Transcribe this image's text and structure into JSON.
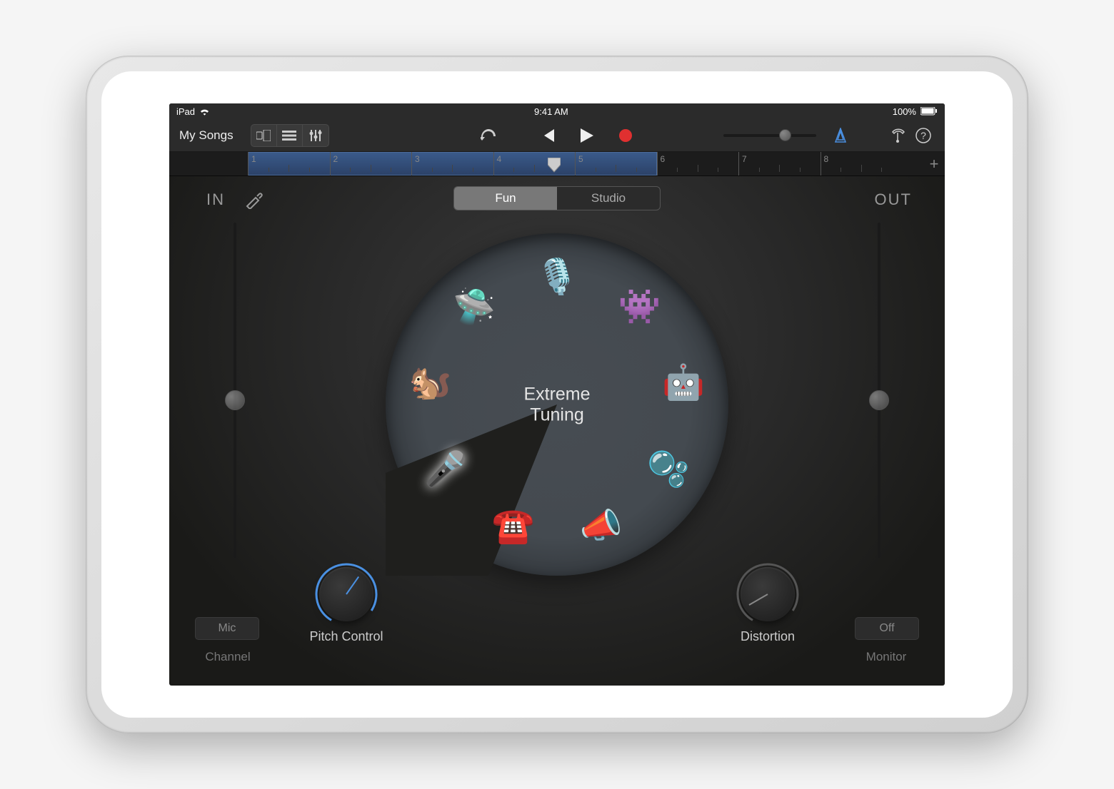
{
  "statusBar": {
    "device": "iPad",
    "time": "9:41 AM",
    "battery": "100%"
  },
  "header": {
    "back": "My Songs"
  },
  "ruler": {
    "bars": [
      "1",
      "2",
      "3",
      "4",
      "5",
      "6",
      "7",
      "8"
    ],
    "regionStartBar": 1,
    "regionEndBar": 5,
    "playheadBar": 4
  },
  "view": {
    "tabs": {
      "fun": "Fun",
      "studio": "Studio",
      "active": "fun"
    },
    "inLabel": "IN",
    "outLabel": "OUT"
  },
  "wheel": {
    "centerLine1": "Extreme",
    "centerLine2": "Tuning",
    "items": [
      {
        "name": "clean-mic",
        "emoji": "🎙️",
        "angle": -90
      },
      {
        "name": "monster",
        "emoji": "👾",
        "angle": -50
      },
      {
        "name": "robot",
        "emoji": "🤖",
        "angle": -10
      },
      {
        "name": "dreamy",
        "emoji": "🫧",
        "angle": 30
      },
      {
        "name": "bullhorn",
        "emoji": "📣",
        "angle": 70
      },
      {
        "name": "telephone",
        "emoji": "☎️",
        "angle": 110
      },
      {
        "name": "extreme-tuning",
        "emoji": "🎤",
        "angle": 150,
        "selected": true
      },
      {
        "name": "chipmunk",
        "emoji": "🐿️",
        "angle": 190
      },
      {
        "name": "alien",
        "emoji": "🛸",
        "angle": 230
      }
    ]
  },
  "controls": {
    "pitchKnob": "Pitch Control",
    "distortionKnob": "Distortion",
    "channelBtn": "Mic",
    "channelLabel": "Channel",
    "monitorBtn": "Off",
    "monitorLabel": "Monitor"
  }
}
